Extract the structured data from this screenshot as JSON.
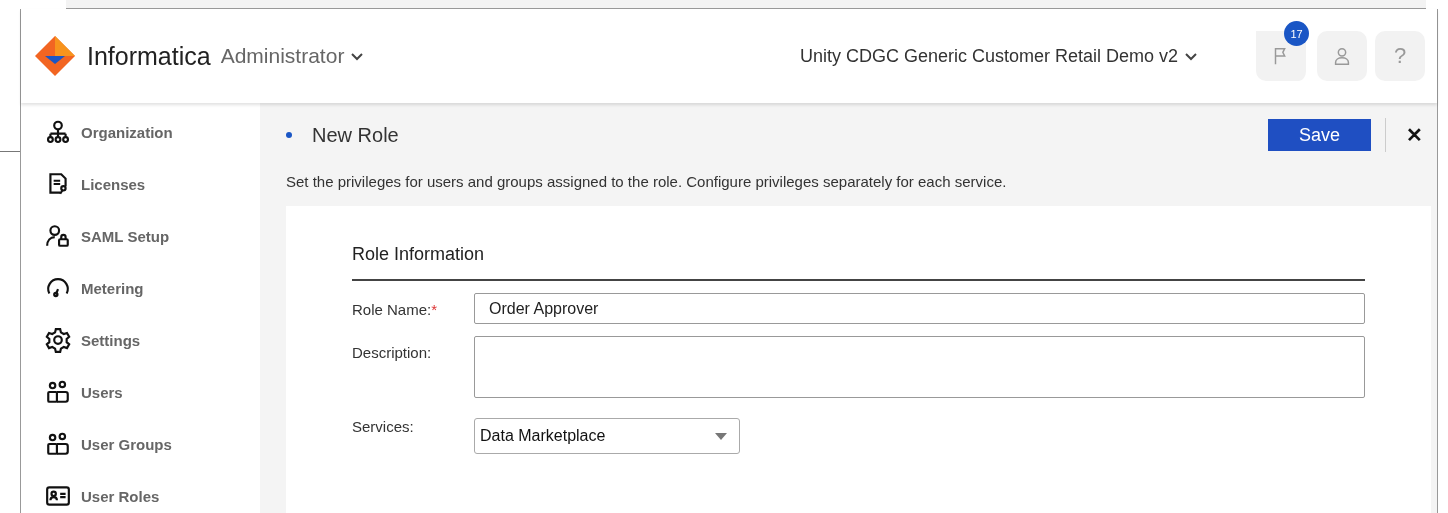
{
  "header": {
    "brand": "Informatica",
    "app_switcher": "Administrator",
    "org_switcher": "Unity CDGC Generic Customer Retail Demo v2",
    "notification_count": "17",
    "help": "?"
  },
  "sidebar": {
    "items": [
      {
        "label": "Organization",
        "kind": "org"
      },
      {
        "label": "Licenses",
        "kind": "license"
      },
      {
        "label": "SAML Setup",
        "kind": "saml"
      },
      {
        "label": "Metering",
        "kind": "meter"
      },
      {
        "label": "Settings",
        "kind": "settings"
      },
      {
        "label": "Users",
        "kind": "users"
      },
      {
        "label": "User Groups",
        "kind": "users"
      },
      {
        "label": "User Roles",
        "kind": "roles"
      }
    ]
  },
  "page": {
    "title": "New Role",
    "save": "Save",
    "close": "✕",
    "description": "Set the privileges for users and groups assigned to the role. Configure privileges separately for each service."
  },
  "form": {
    "section": "Role Information",
    "fields": [
      {
        "label": "Role Name:",
        "required_mark": "*",
        "kind": "text",
        "value": "Order Approver"
      },
      {
        "label": "Description:",
        "kind": "textarea"
      },
      {
        "label": "Services:",
        "kind": "select",
        "value": "Data Marketplace"
      }
    ]
  }
}
